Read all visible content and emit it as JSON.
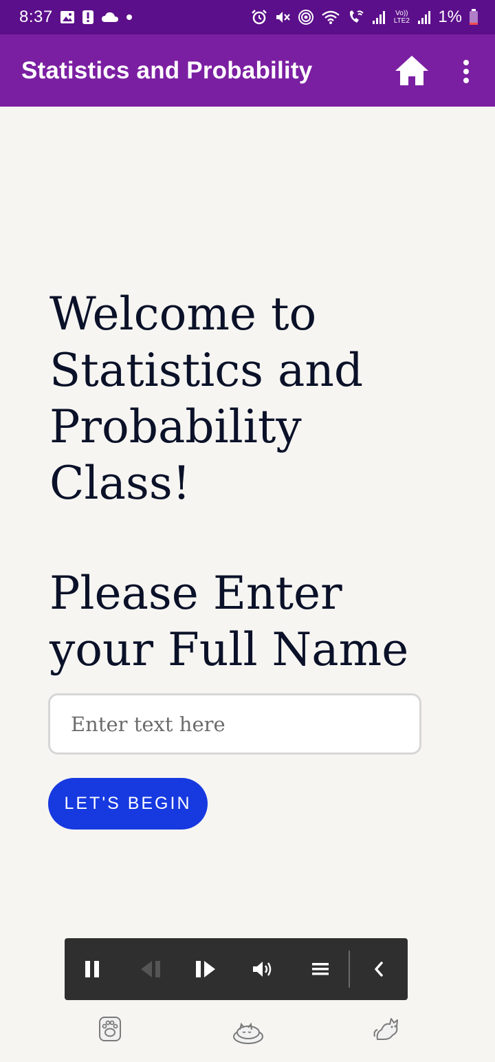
{
  "status_bar": {
    "time": "8:37",
    "battery": "1%",
    "icons_left": [
      "gallery-icon",
      "alert-icon",
      "cloud-icon",
      "dot-icon"
    ],
    "icons_right": [
      "alarm-icon",
      "mute-icon",
      "hotspot-icon",
      "wifi-icon",
      "wifi-calling-icon",
      "signal-icon",
      "volte-icon",
      "signal2-icon",
      "battery-icon"
    ],
    "volte_label": "Vo)) LTE2"
  },
  "app_bar": {
    "title": "Statistics and Probability",
    "background": "#7b1fa2",
    "home_icon": "home-icon",
    "menu_icon": "more-vert-icon"
  },
  "main": {
    "welcome_lines": [
      "Welcome to",
      "Statistics and",
      "Probability",
      "Class!"
    ],
    "prompt_lines": [
      "Please Enter",
      "your Full Name"
    ],
    "name_input": {
      "value": "",
      "placeholder": "Enter text here"
    },
    "begin_button": "LET'S BEGIN",
    "accent": "#1639e0"
  },
  "player": {
    "buttons": [
      "pause-icon",
      "previous-icon",
      "next-icon",
      "volume-icon",
      "menu-icon",
      "collapse-icon"
    ]
  },
  "bottom_icons": [
    "paw-icon",
    "sleeping-cat-icon",
    "playful-cat-icon"
  ]
}
